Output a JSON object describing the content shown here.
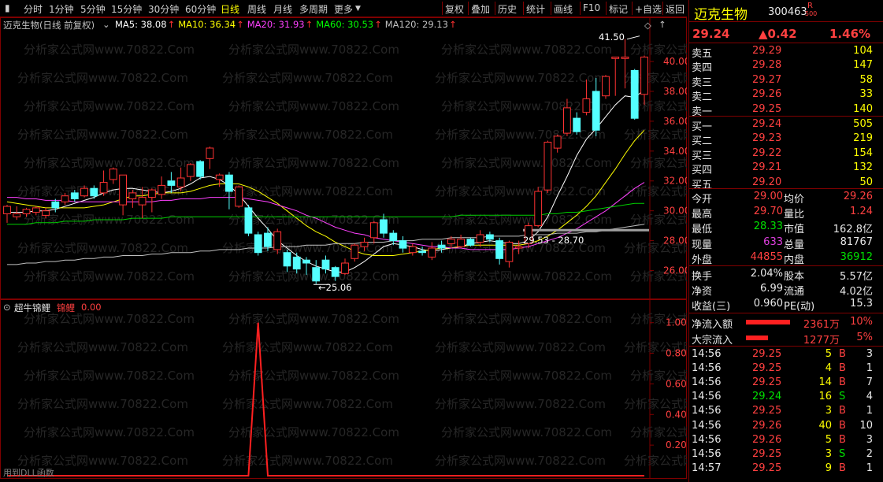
{
  "toolbar": {
    "left_tabs": [
      "分时",
      "1分钟",
      "5分钟",
      "15分钟",
      "30分钟",
      "60分钟",
      "日线",
      "周线",
      "月线",
      "多周期",
      "更多"
    ],
    "active_tab": "日线",
    "right_buttons": [
      "复权",
      "叠加",
      "历史",
      "统计",
      "画线",
      "F10",
      "标记",
      "+自选",
      "返回"
    ]
  },
  "main_chart": {
    "stock_label": "迈克生物(日线 前复权)",
    "ma": [
      {
        "label": "MA5: 38.08",
        "color": "#ffffff"
      },
      {
        "label": "MA10: 36.34",
        "color": "#ffff00"
      },
      {
        "label": "MA20: 31.93",
        "color": "#ff40ff"
      },
      {
        "label": "MA60: 30.53",
        "color": "#00ff00"
      },
      {
        "label": "MA120: 29.13",
        "color": "#c0c0c0"
      }
    ],
    "max_label": "41.50",
    "min_label": "25.06",
    "range_label": "29.53 - 28.70",
    "y_ticks": [
      "40.00",
      "38.00",
      "36.00",
      "34.00",
      "32.00",
      "30.00",
      "28.00",
      "26.00"
    ],
    "watermark": "分析家公式网www.70822.Com"
  },
  "chart_data": {
    "type": "candlestick",
    "ylim": [
      24.6,
      41.8
    ],
    "candles": [
      [
        29.8,
        30.3,
        29.2,
        30.4
      ],
      [
        29.6,
        29.8,
        29.4,
        30.3
      ],
      [
        29.8,
        30.1,
        29.6,
        30.2
      ],
      [
        29.9,
        30.2,
        29.7,
        30.3
      ],
      [
        29.7,
        30.0,
        29.5,
        30.2
      ],
      [
        30.6,
        30.2,
        29.9,
        30.8
      ],
      [
        30.6,
        31.0,
        30.4,
        31.2
      ],
      [
        31.2,
        30.8,
        30.6,
        31.4
      ],
      [
        31.0,
        31.5,
        30.9,
        31.7
      ],
      [
        31.5,
        31.0,
        30.8,
        31.7
      ],
      [
        31.2,
        31.9,
        31.0,
        32.7
      ],
      [
        32.1,
        32.8,
        31.8,
        32.9
      ],
      [
        30.4,
        32.4,
        29.7,
        32.4
      ],
      [
        30.8,
        31.2,
        30.2,
        31.4
      ],
      [
        30.4,
        30.9,
        29.5,
        31.6
      ],
      [
        30.9,
        31.4,
        29.9,
        31.5
      ],
      [
        31.1,
        31.7,
        30.8,
        32.3
      ],
      [
        32.0,
        31.7,
        31.2,
        32.6
      ],
      [
        31.6,
        32.2,
        31.3,
        32.9
      ],
      [
        32.3,
        33.1,
        32.0,
        33.2
      ],
      [
        33.3,
        32.3,
        32.1,
        33.4
      ],
      [
        33.5,
        34.2,
        32.8,
        34.3
      ],
      [
        32.1,
        32.4,
        31.6,
        32.5
      ],
      [
        32.4,
        31.3,
        30.1,
        32.6
      ],
      [
        30.3,
        31.6,
        30.2,
        31.7
      ],
      [
        30.2,
        28.5,
        28.3,
        30.4
      ],
      [
        28.4,
        27.2,
        27.0,
        28.6
      ],
      [
        28.5,
        27.6,
        27.3,
        28.9
      ],
      [
        27.4,
        28.6,
        27.1,
        28.8
      ],
      [
        27.2,
        26.3,
        25.9,
        27.4
      ],
      [
        26.9,
        26.1,
        25.8,
        27.2
      ],
      [
        26.7,
        26.5,
        25.7,
        26.9
      ],
      [
        26.2,
        25.3,
        25.1,
        26.7
      ],
      [
        26.7,
        26.1,
        25.8,
        27.0
      ],
      [
        26.2,
        25.6,
        25.3,
        26.3
      ],
      [
        25.8,
        26.5,
        25.7,
        26.8
      ],
      [
        26.8,
        27.7,
        26.6,
        27.8
      ],
      [
        27.6,
        27.9,
        27.3,
        28.2
      ],
      [
        28.2,
        29.2,
        27.8,
        29.3
      ],
      [
        29.4,
        28.5,
        28.2,
        29.8
      ],
      [
        28.5,
        28.0,
        27.7,
        28.7
      ],
      [
        28.0,
        27.5,
        27.2,
        28.3
      ],
      [
        27.2,
        27.6,
        27.0,
        27.8
      ],
      [
        27.3,
        27.2,
        27.0,
        27.6
      ],
      [
        26.9,
        27.5,
        26.7,
        27.9
      ],
      [
        27.7,
        27.5,
        27.2,
        28.0
      ],
      [
        27.8,
        28.1,
        27.5,
        28.3
      ],
      [
        27.6,
        28.1,
        27.5,
        28.4
      ],
      [
        28.1,
        27.7,
        27.6,
        28.2
      ],
      [
        27.9,
        28.4,
        27.6,
        28.7
      ],
      [
        28.4,
        28.1,
        27.9,
        28.6
      ],
      [
        28.0,
        26.8,
        26.4,
        28.2
      ],
      [
        26.6,
        27.9,
        26.2,
        28.0
      ],
      [
        27.5,
        27.6,
        27.1,
        28.0
      ],
      [
        27.8,
        29.0,
        27.5,
        29.2
      ],
      [
        29.0,
        31.3,
        28.9,
        31.6
      ],
      [
        31.4,
        34.6,
        31.2,
        34.7
      ],
      [
        34.2,
        35.0,
        33.9,
        35.1
      ],
      [
        35.2,
        36.9,
        35.0,
        37.5
      ],
      [
        36.2,
        35.3,
        35.1,
        36.6
      ],
      [
        36.6,
        37.5,
        36.4,
        38.8
      ],
      [
        38.0,
        35.4,
        35.0,
        38.9
      ],
      [
        37.7,
        39.0,
        37.5,
        39.1
      ],
      [
        40.2,
        40.3,
        37.7,
        40.3
      ],
      [
        40.2,
        40.3,
        38.2,
        41.5
      ],
      [
        39.4,
        36.2,
        36.1,
        39.5
      ],
      [
        37.8,
        40.3,
        37.1,
        40.4
      ]
    ],
    "ma_lines": {
      "MA5": [
        29.9,
        29.9,
        29.9,
        30.0,
        30.0,
        30.1,
        30.3,
        30.5,
        30.7,
        30.9,
        31.2,
        31.4,
        31.5,
        31.5,
        31.4,
        31.3,
        31.2,
        31.3,
        31.5,
        31.8,
        32.2,
        32.3,
        32.1,
        31.7,
        31.1,
        30.3,
        29.5,
        28.8,
        28.0,
        27.5,
        27.0,
        26.6,
        26.3,
        26.1,
        25.9,
        25.9,
        26.2,
        26.6,
        27.1,
        27.6,
        27.8,
        27.7,
        27.6,
        27.4,
        27.3,
        27.4,
        27.5,
        27.6,
        27.8,
        27.9,
        28.0,
        27.9,
        27.8,
        27.8,
        28.0,
        28.6,
        29.6,
        31.0,
        32.3,
        33.7,
        34.8,
        35.5,
        36.3,
        37.1,
        37.7,
        37.6,
        38.1
      ],
      "MA10": [
        30.6,
        30.5,
        30.4,
        30.3,
        30.2,
        30.2,
        30.2,
        30.2,
        30.2,
        30.3,
        30.4,
        30.6,
        30.8,
        31.0,
        31.0,
        31.1,
        31.2,
        31.2,
        31.2,
        31.3,
        31.5,
        31.7,
        31.8,
        31.8,
        31.8,
        31.6,
        31.3,
        30.9,
        30.5,
        30.0,
        29.5,
        29.0,
        28.6,
        28.3,
        27.9,
        27.6,
        27.3,
        27.1,
        27.0,
        27.0,
        27.0,
        27.1,
        27.2,
        27.3,
        27.4,
        27.5,
        27.5,
        27.6,
        27.7,
        27.7,
        27.7,
        27.7,
        27.7,
        27.7,
        27.8,
        28.0,
        28.3,
        28.7,
        29.2,
        29.7,
        30.3,
        31.0,
        31.9,
        32.8,
        33.8,
        34.7,
        35.4
      ],
      "MA20": [
        30.9,
        30.9,
        30.8,
        30.8,
        30.7,
        30.7,
        30.7,
        30.6,
        30.6,
        30.6,
        30.6,
        30.6,
        30.6,
        30.6,
        30.6,
        30.6,
        30.7,
        30.7,
        30.8,
        30.8,
        30.8,
        30.9,
        30.9,
        30.9,
        30.9,
        30.8,
        30.7,
        30.6,
        30.4,
        30.2,
        30.0,
        29.7,
        29.5,
        29.2,
        28.9,
        28.7,
        28.5,
        28.4,
        28.2,
        28.1,
        28.0,
        27.9,
        27.8,
        27.7,
        27.6,
        27.6,
        27.5,
        27.5,
        27.4,
        27.4,
        27.4,
        27.4,
        27.4,
        27.5,
        27.6,
        27.8,
        28.0,
        28.2,
        28.5,
        28.8,
        29.2,
        29.6,
        30.0,
        30.5,
        31.0,
        31.5,
        31.9
      ],
      "MA60": [
        29.1,
        29.1,
        29.1,
        29.2,
        29.2,
        29.2,
        29.3,
        29.3,
        29.3,
        29.4,
        29.4,
        29.4,
        29.4,
        29.5,
        29.5,
        29.5,
        29.5,
        29.6,
        29.6,
        29.6,
        29.6,
        29.6,
        29.6,
        29.6,
        29.6,
        29.6,
        29.6,
        29.6,
        29.6,
        29.6,
        29.6,
        29.6,
        29.6,
        29.6,
        29.6,
        29.6,
        29.6,
        29.6,
        29.6,
        29.6,
        29.6,
        29.6,
        29.6,
        29.6,
        29.6,
        29.6,
        29.6,
        29.7,
        29.7,
        29.7,
        29.7,
        29.7,
        29.7,
        29.7,
        29.7,
        29.7,
        29.8,
        29.8,
        29.9,
        29.9,
        30.0,
        30.1,
        30.2,
        30.3,
        30.4,
        30.5,
        30.5
      ],
      "MA120": [
        26.4,
        26.4,
        26.5,
        26.5,
        26.6,
        26.6,
        26.7,
        26.7,
        26.8,
        26.8,
        26.9,
        26.9,
        27.0,
        27.0,
        27.0,
        27.1,
        27.1,
        27.2,
        27.2,
        27.2,
        27.3,
        27.3,
        27.4,
        27.4,
        27.4,
        27.5,
        27.5,
        27.5,
        27.6,
        27.6,
        27.6,
        27.7,
        27.7,
        27.7,
        27.8,
        27.8,
        27.8,
        27.9,
        27.9,
        27.9,
        28.0,
        28.0,
        28.0,
        28.1,
        28.1,
        28.1,
        28.2,
        28.2,
        28.2,
        28.2,
        28.3,
        28.3,
        28.3,
        28.3,
        28.4,
        28.4,
        28.4,
        28.5,
        28.5,
        28.5,
        28.6,
        28.6,
        28.7,
        28.8,
        28.9,
        29.0,
        29.1
      ]
    },
    "indicator": {
      "name": "超牛锦鲤",
      "series": "锦鲤",
      "value": "0.00",
      "ylim": [
        0,
        1.05
      ],
      "spike_index": 26,
      "y_ticks": [
        "1.00",
        "0.80",
        "0.60",
        "0.40",
        "0.20"
      ]
    }
  },
  "status_text": "用到DLL函数",
  "quote": {
    "name": "迈克生物",
    "code": "300463",
    "flag_r": "R",
    "flag_500": "500",
    "price": "29.24",
    "change": "▲0.42",
    "pct": "1.46%",
    "asks": [
      {
        "label": "卖五",
        "price": "29.29",
        "vol": "104"
      },
      {
        "label": "卖四",
        "price": "29.28",
        "vol": "147"
      },
      {
        "label": "卖三",
        "price": "29.27",
        "vol": "58"
      },
      {
        "label": "卖二",
        "price": "29.26",
        "vol": "33"
      },
      {
        "label": "卖一",
        "price": "29.25",
        "vol": "140"
      }
    ],
    "bids": [
      {
        "label": "买一",
        "price": "29.24",
        "vol": "505"
      },
      {
        "label": "买二",
        "price": "29.23",
        "vol": "219"
      },
      {
        "label": "买三",
        "price": "29.22",
        "vol": "154"
      },
      {
        "label": "买四",
        "price": "29.21",
        "vol": "132"
      },
      {
        "label": "买五",
        "price": "29.20",
        "vol": "50"
      }
    ],
    "stats": [
      {
        "l1": "今开",
        "v1": "29.00",
        "c1": "red",
        "l2": "均价",
        "v2": "29.26",
        "c2": "red"
      },
      {
        "l1": "最高",
        "v1": "29.70",
        "c1": "red",
        "l2": "量比",
        "v2": "1.24",
        "c2": "red"
      },
      {
        "l1": "最低",
        "v1": "28.33",
        "c1": "green",
        "l2": "市值",
        "v2": "162.8亿",
        "c2": "white"
      },
      {
        "l1": "现量",
        "v1": "633",
        "c1": "purple",
        "l2": "总量",
        "v2": "81767",
        "c2": "white"
      },
      {
        "l1": "外盘",
        "v1": "44855",
        "c1": "red",
        "l2": "内盘",
        "v2": "36912",
        "c2": "green"
      }
    ],
    "fundamentals": [
      {
        "l1": "换手",
        "v1": "2.04%",
        "l2": "股本",
        "v2": "5.57亿"
      },
      {
        "l1": "净资",
        "v1": "6.99",
        "l2": "流通",
        "v2": "4.02亿"
      },
      {
        "l1": "收益(三)",
        "v1": "0.960",
        "l2": "PE(动)",
        "v2": "15.3"
      }
    ],
    "flows": [
      {
        "label": "净流入额",
        "amount": "2361万",
        "pct": "10%"
      },
      {
        "label": "大宗流入",
        "amount": "1277万",
        "pct": "5%"
      }
    ],
    "ticks": [
      {
        "t": "14:56",
        "p": "29.25",
        "v": "5",
        "d": "B",
        "n": "3"
      },
      {
        "t": "14:56",
        "p": "29.25",
        "v": "4",
        "d": "B",
        "n": "1"
      },
      {
        "t": "14:56",
        "p": "29.25",
        "v": "14",
        "d": "B",
        "n": "7"
      },
      {
        "t": "14:56",
        "p": "29.24",
        "v": "16",
        "d": "S",
        "n": "4"
      },
      {
        "t": "14:56",
        "p": "29.25",
        "v": "3",
        "d": "B",
        "n": "1"
      },
      {
        "t": "14:56",
        "p": "29.26",
        "v": "40",
        "d": "B",
        "n": "10"
      },
      {
        "t": "14:56",
        "p": "29.26",
        "v": "5",
        "d": "B",
        "n": "3"
      },
      {
        "t": "14:56",
        "p": "29.25",
        "v": "3",
        "d": "S",
        "n": "2"
      },
      {
        "t": "14:57",
        "p": "29.25",
        "v": "9",
        "d": "B",
        "n": "1"
      }
    ]
  }
}
